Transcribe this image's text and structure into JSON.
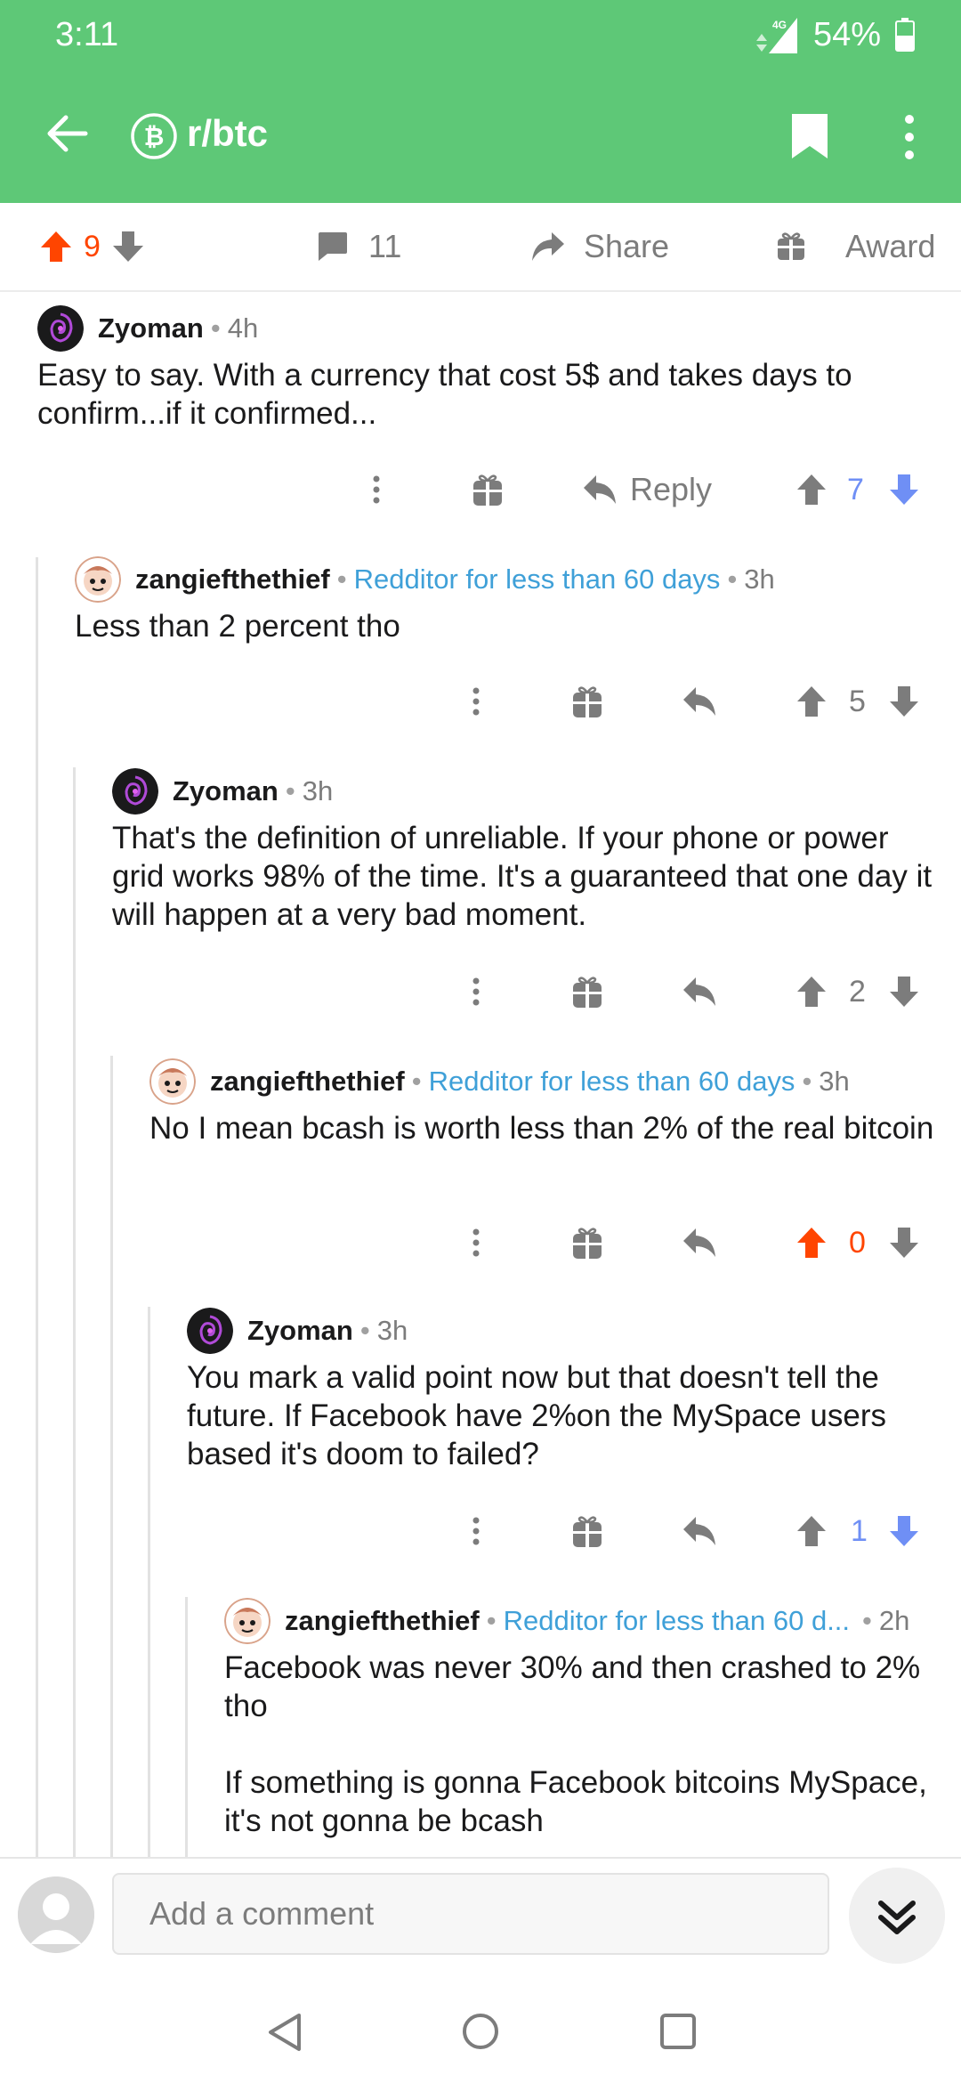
{
  "status_bar": {
    "time": "3:11",
    "network": "4G",
    "battery": "54%"
  },
  "header": {
    "subreddit": "r/btc"
  },
  "post_actions": {
    "score": "9",
    "comments": "11",
    "share_label": "Share",
    "award_label": "Award"
  },
  "comments": [
    {
      "author": "Zyoman",
      "flair": "",
      "age": "4h",
      "body": "Easy to say. With a currency that cost 5$ and takes days to confirm...if it confirmed...",
      "reply_label": "Reply",
      "score": "7"
    },
    {
      "author": "zangiefthethief",
      "flair": "Redditor for less than 60 days",
      "age": "3h",
      "body": "Less than 2 percent tho",
      "score": "5"
    },
    {
      "author": "Zyoman",
      "flair": "",
      "age": "3h",
      "body": "That's the definition of unreliable. If your phone or power grid works 98% of the time. It's a guaranteed that one day it will happen at a very bad moment.",
      "score": "2"
    },
    {
      "author": "zangiefthethief",
      "flair": "Redditor for less than 60 days",
      "age": "3h",
      "body": "No I mean bcash is worth less than 2% of the real bitcoin",
      "score": "0"
    },
    {
      "author": "Zyoman",
      "flair": "",
      "age": "3h",
      "body": "You mark a valid point now but that doesn't tell the future. If Facebook have 2%on the MySpace users based it's doom to failed?",
      "score": "1"
    },
    {
      "author": "zangiefthethief",
      "flair": "Redditor for less than 60 d...",
      "age": "2h",
      "body1": "Facebook was never 30% and then crashed to 2% tho",
      "body2": "If something is gonna Facebook bitcoins MySpace, it's not gonna be bcash"
    }
  ],
  "composer": {
    "placeholder": "Add a comment"
  },
  "colors": {
    "header": "#5ec877",
    "upvote_active": "#ff4500",
    "downvote_active": "#6f8ff5",
    "flair": "#3fa0d8"
  },
  "icons": [
    "back-arrow-icon",
    "bitcoin-icon",
    "bookmark-icon",
    "more-icon",
    "upvote-icon",
    "downvote-icon",
    "comment-icon",
    "share-icon",
    "gift-icon",
    "reply-icon",
    "chevron-double-down-icon",
    "nav-back-icon",
    "nav-home-icon",
    "nav-recents-icon"
  ]
}
